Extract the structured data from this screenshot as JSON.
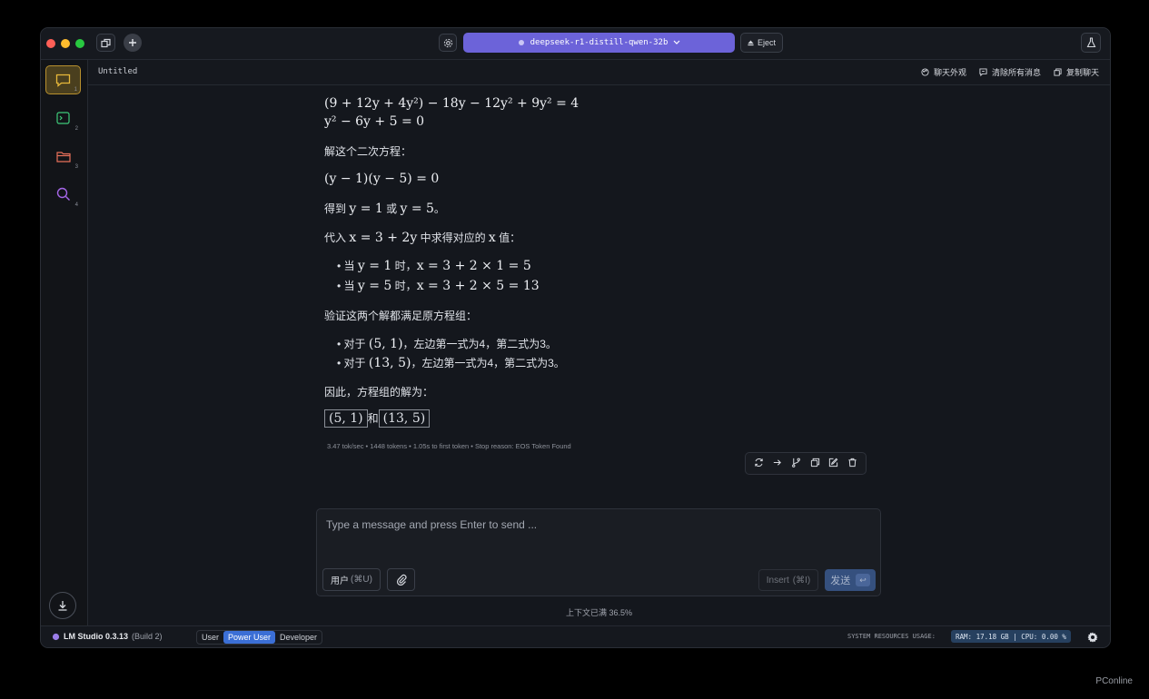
{
  "titlebar": {
    "model_name": "deepseek-r1-distill-qwen-32b",
    "eject_label": "Eject"
  },
  "sidebar": {
    "items": [
      {
        "icon": "chat-icon",
        "num": "1",
        "color": "#e8b93a"
      },
      {
        "icon": "terminal-icon",
        "num": "2",
        "color": "#3ecb7a"
      },
      {
        "icon": "folder-icon",
        "num": "3",
        "color": "#e8705a"
      },
      {
        "icon": "search-icon",
        "num": "4",
        "color": "#a566e8"
      }
    ]
  },
  "chat_header": {
    "title": "Untitled",
    "actions": [
      {
        "icon": "palette-icon",
        "label": "聊天外观"
      },
      {
        "icon": "clear-messages-icon",
        "label": "清除所有消息"
      },
      {
        "icon": "copy-icon",
        "label": "复制聊天"
      }
    ]
  },
  "message": {
    "eq1": "(9 + 12y + 4y²) − 18y − 12y² + 9y² = 4",
    "eq2": "y² − 6y + 5 = 0",
    "t_solve": "解这个二次方程：",
    "eq3": "(y − 1)(y − 5) = 0",
    "t_result_prefix": "得到 ",
    "t_result_math": "y = 1",
    "t_result_mid": " 或 ",
    "t_result_math2": "y = 5",
    "t_result_end": "。",
    "t_sub_prefix": "代入 ",
    "t_sub_math": "x = 3 + 2y",
    "t_sub_mid": " 中求得对应的 ",
    "t_sub_math2": "x",
    "t_sub_end": " 值：",
    "b1_prefix": "当 ",
    "b1_math": "y = 1",
    "b1_mid": " 时，",
    "b1_math2": "x = 3 + 2 × 1 = 5",
    "b2_prefix": "当 ",
    "b2_math": "y = 5",
    "b2_mid": " 时，",
    "b2_math2": "x = 3 + 2 × 5 = 13",
    "t_verify": "验证这两个解都满足原方程组：",
    "v1_prefix": "对于 ",
    "v1_math": "(5, 1)",
    "v1_rest": "，左边第一式为4，第二式为3。",
    "v2_prefix": "对于 ",
    "v2_math": "(13, 5)",
    "v2_rest": "，左边第一式为4，第二式为3。",
    "t_therefore": "因此，方程组的解为：",
    "ans1": "(5, 1)",
    "ans_and": "和",
    "ans2": "(13, 5)",
    "stats": "3.47 tok/sec  •  1448 tokens  •  1.05s to first token  •  Stop reason: EOS Token Found"
  },
  "composer": {
    "placeholder": "Type a message and press Enter to send ...",
    "role_label": "用户",
    "role_shortcut": "(⌘U)",
    "insert_label": "Insert",
    "insert_shortcut": "(⌘I)",
    "send_label": "发送",
    "send_key": "↩"
  },
  "context_usage": "上下文已满 36.5%",
  "statusbar": {
    "app_name": "LM Studio 0.3.13",
    "build": "(Build 2)",
    "modes": [
      "User",
      "Power User",
      "Developer"
    ],
    "active_mode": "Power User",
    "sys_label": "SYSTEM RESOURCES USAGE:",
    "sys_value": "RAM: 17.18 GB  |  CPU: 0.00 %"
  },
  "watermark": "PConline"
}
